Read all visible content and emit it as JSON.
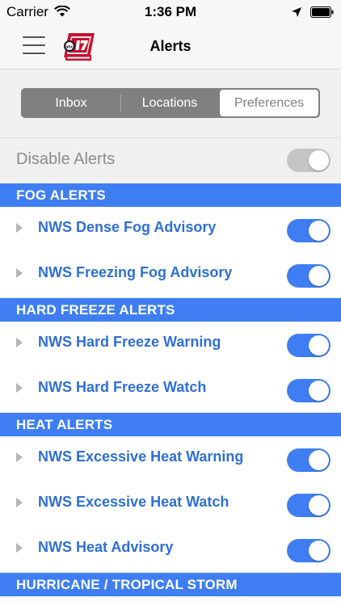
{
  "status_bar": {
    "carrier": "Carrier",
    "time": "1:36 PM"
  },
  "nav": {
    "title": "Alerts"
  },
  "tabs": [
    {
      "label": "Inbox",
      "active": false
    },
    {
      "label": "Locations",
      "active": false
    },
    {
      "label": "Preferences",
      "active": true
    }
  ],
  "disable_alerts": {
    "label": "Disable Alerts",
    "enabled": false
  },
  "sections": [
    {
      "header": "FOG ALERTS",
      "items": [
        {
          "label": "NWS Dense Fog Advisory",
          "enabled": true
        },
        {
          "label": "NWS Freezing Fog Advisory",
          "enabled": true
        }
      ]
    },
    {
      "header": "HARD FREEZE ALERTS",
      "items": [
        {
          "label": "NWS Hard Freeze Warning",
          "enabled": true
        },
        {
          "label": "NWS Hard Freeze Watch",
          "enabled": true
        }
      ]
    },
    {
      "header": "HEAT ALERTS",
      "items": [
        {
          "label": "NWS Excessive Heat Warning",
          "enabled": true
        },
        {
          "label": "NWS Excessive Heat Watch",
          "enabled": true
        },
        {
          "label": "NWS Heat Advisory",
          "enabled": true
        }
      ]
    },
    {
      "header": "HURRICANE / TROPICAL STORM",
      "items": []
    }
  ],
  "colors": {
    "accent": "#3f7ef2",
    "item_text": "#2f6fd6",
    "toggle_off": "#c4c4c4"
  },
  "icons": [
    "wifi-icon",
    "location-arrow-icon",
    "battery-icon",
    "hamburger-menu-icon",
    "station-logo",
    "disclosure-caret-icon"
  ]
}
